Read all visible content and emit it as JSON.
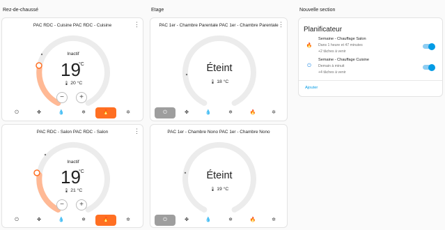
{
  "sections": {
    "rdc": "Rez-de-chaussé",
    "etage": "Etage",
    "nouvelle": "Nouvelle section"
  },
  "thermostats": {
    "cuisine": {
      "title": "PAC RDC - Cuisine PAC RDC - Cuisine",
      "state": "Inactif",
      "target": "19",
      "unit": "°C",
      "current": "20 °C",
      "minus": "−",
      "plus": "+",
      "active_mode": "heat",
      "level": 0.32
    },
    "salon": {
      "title": "PAC RDC - Salon PAC RDC - Salon",
      "state": "Inactif",
      "target": "19",
      "unit": "°C",
      "current": "21 °C",
      "minus": "−",
      "plus": "+",
      "active_mode": "heat",
      "level": 0.32
    },
    "parentale": {
      "title": "PAC 1er - Chambre Parentale PAC 1er - Chambre Parentale",
      "state": "Éteint",
      "current": "18 °C",
      "active_mode": "off"
    },
    "nono": {
      "title": "PAC 1er - Chambre Nono PAC 1er - Chambre Nono",
      "state": "Éteint",
      "current": "19 °C",
      "active_mode": "off"
    }
  },
  "mode_icons": [
    "power-icon",
    "fan-icon",
    "dry-icon",
    "cool-icon",
    "heat-icon",
    "heat-cool-icon"
  ],
  "scheduler": {
    "title": "Planificateur",
    "items": [
      {
        "name": "Semaine - Chauffage Salon",
        "line1": "Dans 1 heure et 47 minutes",
        "line2": "+2 tâches à venir",
        "icon": "fire-icon",
        "enabled": true
      },
      {
        "name": "Semaine - Chauffage Cuisine",
        "line1": "Demain à minuit",
        "line2": "+4 tâches à venir",
        "icon": "power-icon",
        "enabled": true
      }
    ],
    "add_label": "Ajouter"
  },
  "colors": {
    "heat": "#ff6f22",
    "heat_light": "#ffb995",
    "track": "#ececec",
    "off_active": "#9e9e9e",
    "accent": "#039be5"
  }
}
